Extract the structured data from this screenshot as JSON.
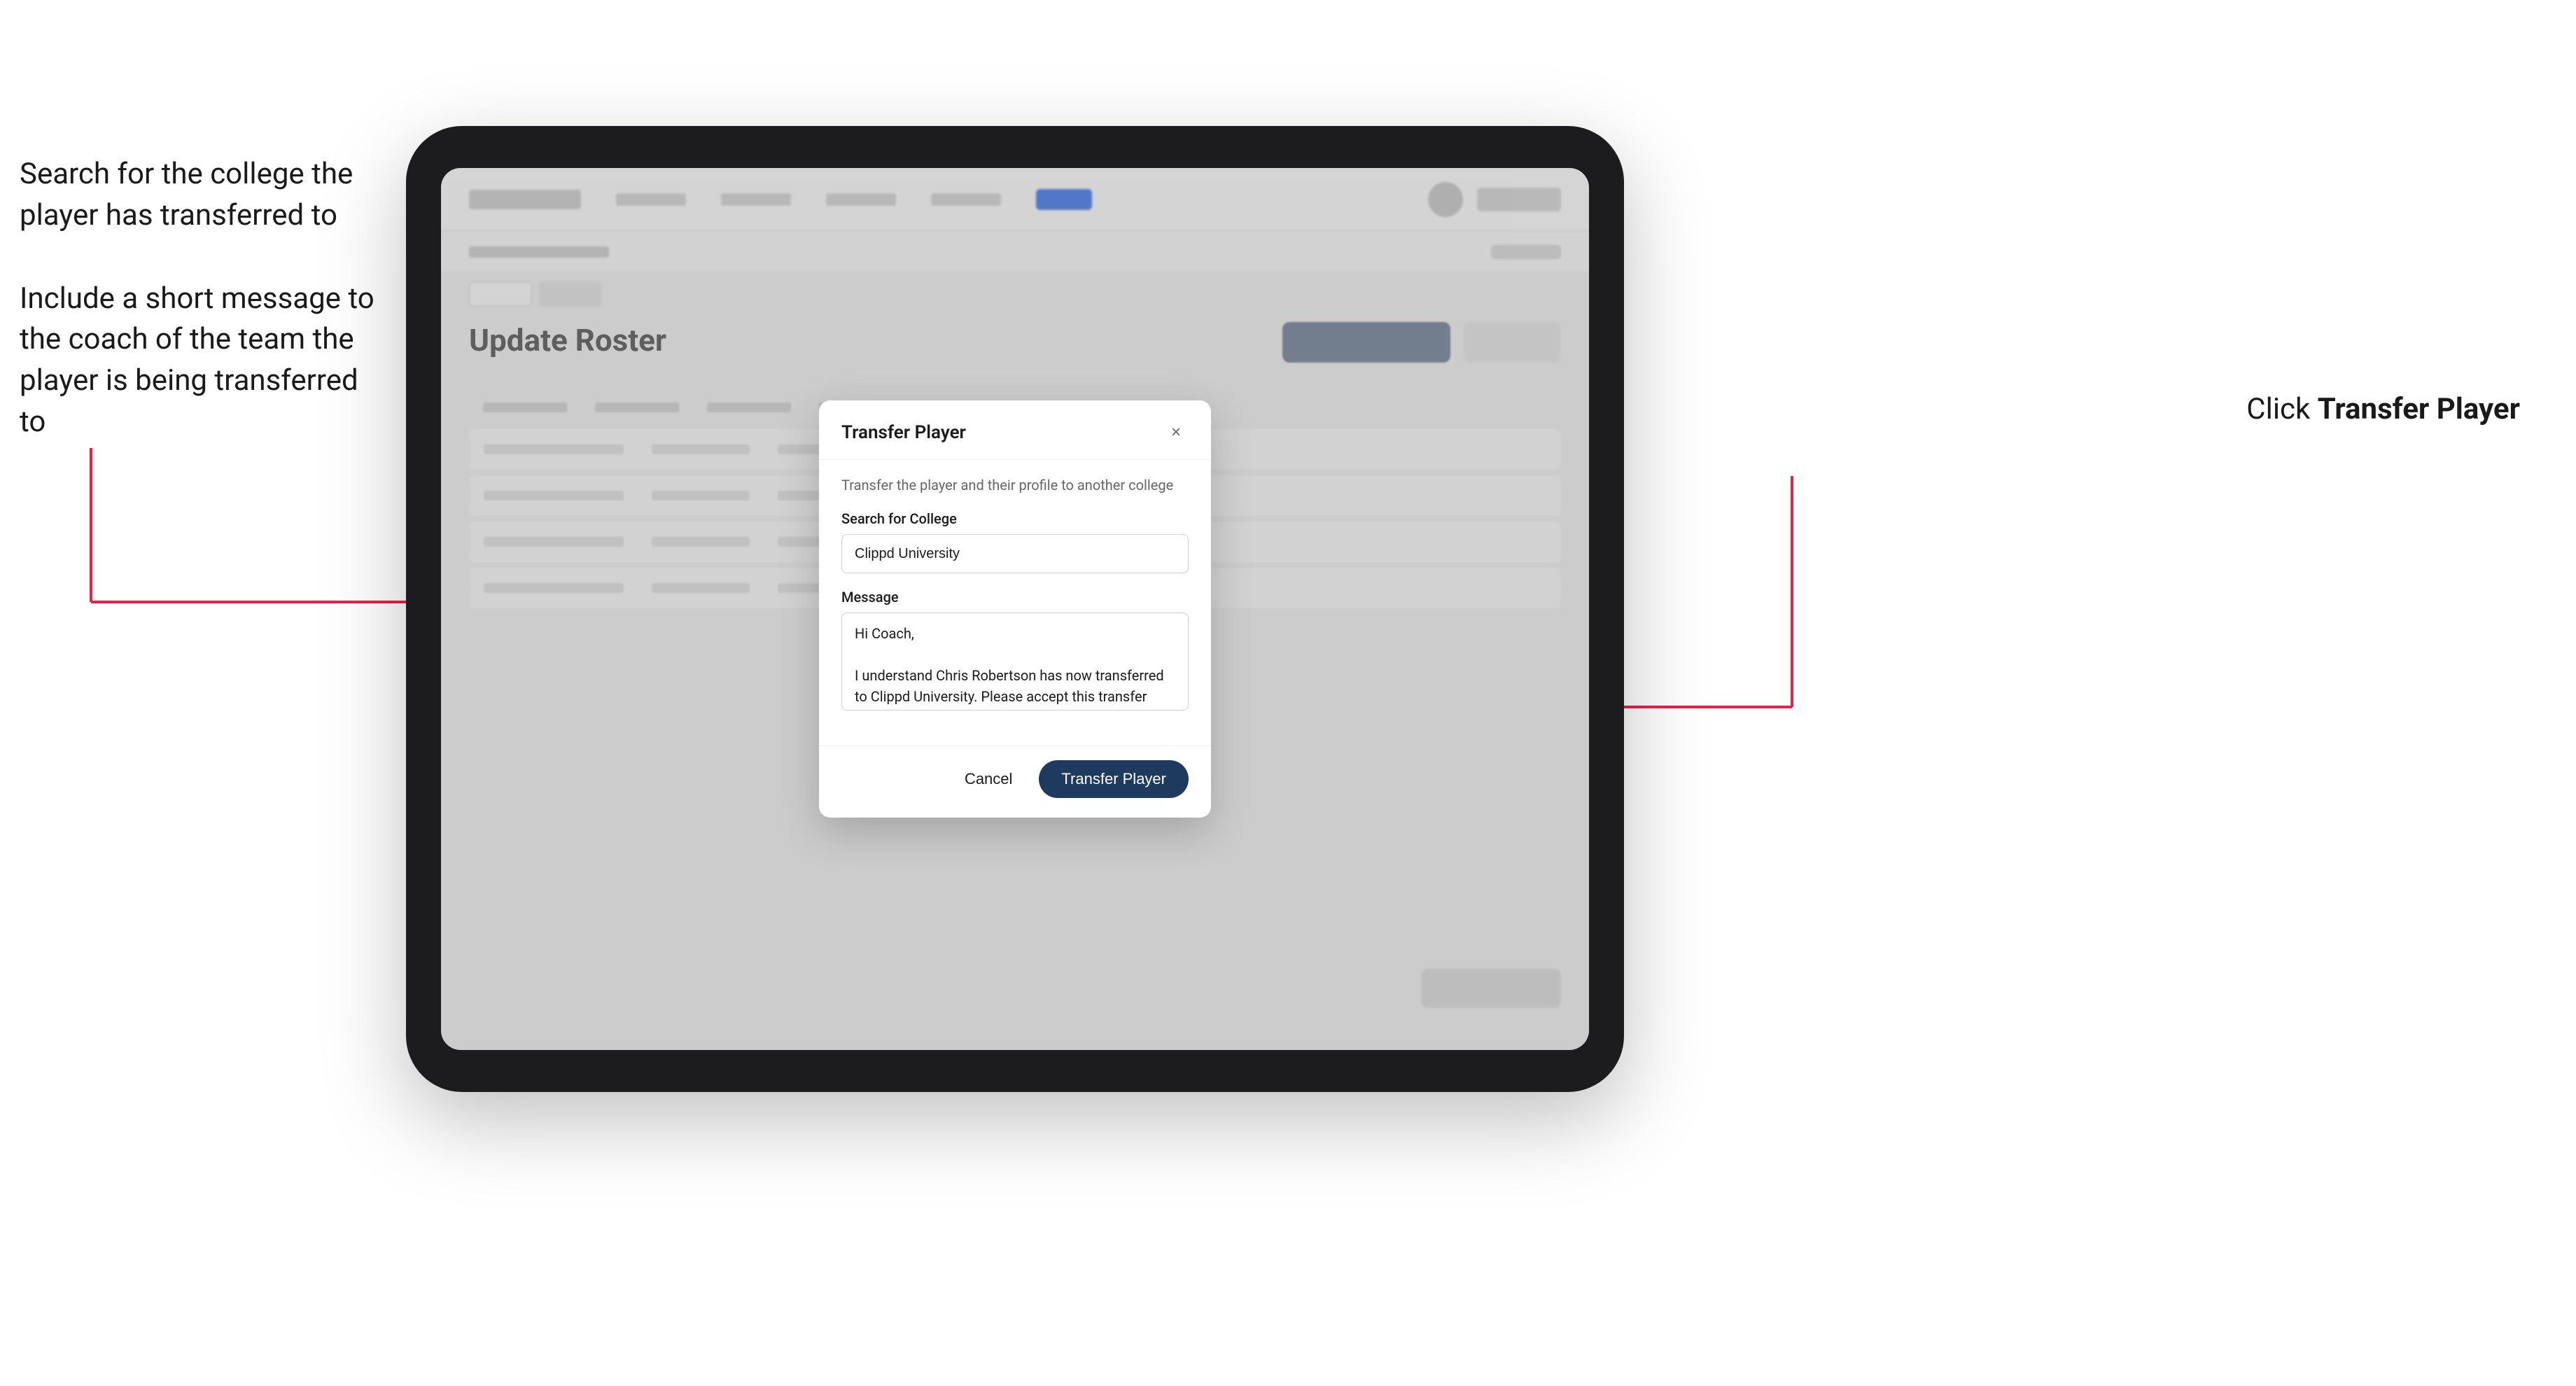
{
  "annotations": {
    "left_top": "Search for the college the player has transferred to",
    "left_bottom": "Include a short message to the coach of the team the player is being transferred to",
    "right": "Click",
    "right_bold": "Transfer Player"
  },
  "modal": {
    "title": "Transfer Player",
    "close_label": "×",
    "subtitle": "Transfer the player and their profile to another college",
    "search_label": "Search for College",
    "search_value": "Clippd University",
    "search_placeholder": "Search for College",
    "message_label": "Message",
    "message_value": "Hi Coach,\n\nI understand Chris Robertson has now transferred to Clippd University. Please accept this transfer request when you can.",
    "cancel_label": "Cancel",
    "transfer_label": "Transfer Player"
  },
  "page": {
    "title": "Update Roster"
  }
}
